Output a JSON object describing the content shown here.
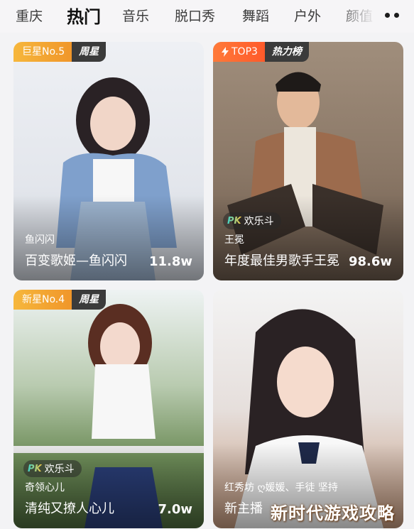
{
  "nav": {
    "tabs": [
      {
        "label": "重庆"
      },
      {
        "label": "热门"
      },
      {
        "label": "音乐"
      },
      {
        "label": "脱口秀"
      },
      {
        "label": "舞蹈"
      },
      {
        "label": "户外"
      },
      {
        "label": "颜值"
      }
    ],
    "active_tab": "热门",
    "more_icon": "more-dots-icon"
  },
  "cards": [
    {
      "badge_main": "巨星No.5",
      "badge_sub": "周星",
      "owner": "鱼闪闪",
      "title": "百变歌姬—鱼闪闪",
      "count": "11.8w"
    },
    {
      "badge_main": "TOP3",
      "badge_icon": "lightning-icon",
      "badge_sub": "热力榜",
      "pk_label": "欢乐斗",
      "owner": "王冕",
      "title": "年度最佳男歌手王冕",
      "count": "98.6w"
    },
    {
      "badge_main": "新星No.4",
      "badge_sub": "周星",
      "pk_label": "欢乐斗",
      "owner": "奇领心儿",
      "title": "清纯又撩人心儿",
      "count": "7.0w"
    },
    {
      "owner": "红秀坊 ღ媛媛、手徒 坚持",
      "title": "新主播",
      "watermark": "新时代游戏攻略"
    }
  ],
  "colors": {
    "badge_gold": "#f0962a",
    "badge_hot": "#ff5a2a",
    "badge_dark": "#3b3b3b"
  }
}
